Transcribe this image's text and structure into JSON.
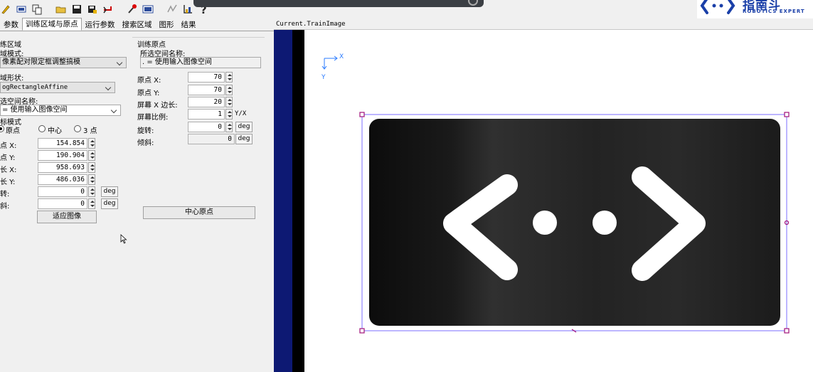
{
  "toolbar": {
    "icons": [
      "pencil-icon",
      "roi-icon",
      "copy-icon",
      "open-folder-icon",
      "save-icon",
      "save-as-icon",
      "undo-icon",
      "train-icon",
      "image-icon",
      "run-icon",
      "graph-icon",
      "help-icon"
    ]
  },
  "logo": {
    "cn": "指南斗",
    "en": "ROBOTICS EXPERT"
  },
  "tabs": [
    "参数",
    "训练区域与原点",
    "运行参数",
    "搜索区域",
    "图形",
    "结果"
  ],
  "left": {
    "group_title": "练区域",
    "region_mode_label": "域模式:",
    "region_mode_value": "像素配对限定框调整搞模",
    "region_shape_label": "域形状:",
    "region_shape_value": "ogRectangleAffine",
    "space_name_label": "选空间名称:",
    "space_name_value": "= 使用输入图像空间",
    "coord_mode_label": "标模式",
    "radio_origin": "原点",
    "radio_center": "中心",
    "radio_3pt": "3 点",
    "rows": [
      {
        "label": "点 X:",
        "value": "154.854"
      },
      {
        "label": "点 Y:",
        "value": "190.904"
      },
      {
        "label": "长 X:",
        "value": "958.693"
      },
      {
        "label": "长 Y:",
        "value": "486.036"
      },
      {
        "label": "转:",
        "value": "0"
      },
      {
        "label": "斜:",
        "value": "0"
      }
    ],
    "deg": "deg",
    "fit_button": "适应图像"
  },
  "right": {
    "group_title": "训练原点",
    "space_name_label": "所选空间名称:",
    "space_name_value": ". = 使用输入图像空间",
    "rows": [
      {
        "label": "原点 X:",
        "value": "70"
      },
      {
        "label": "原点 Y:",
        "value": "70"
      },
      {
        "label": "屏幕 X 边长:",
        "value": "20"
      },
      {
        "label": "屏幕比例:",
        "value": "1",
        "unit": "Y/X"
      },
      {
        "label": "旋转:",
        "value": "0",
        "unit": "deg"
      },
      {
        "label": "倾斜:",
        "value": "0",
        "unit": "deg"
      }
    ],
    "center_button": "中心原点"
  },
  "viewer": {
    "title": "Current.TrainImage",
    "axis_x": "X",
    "axis_y": "Y"
  },
  "colors": {
    "navy": "#0d1973",
    "roi": "#7b6cff",
    "handle": "#a0107a",
    "card": "#1d1d1d",
    "brand": "#1a3fa8"
  }
}
